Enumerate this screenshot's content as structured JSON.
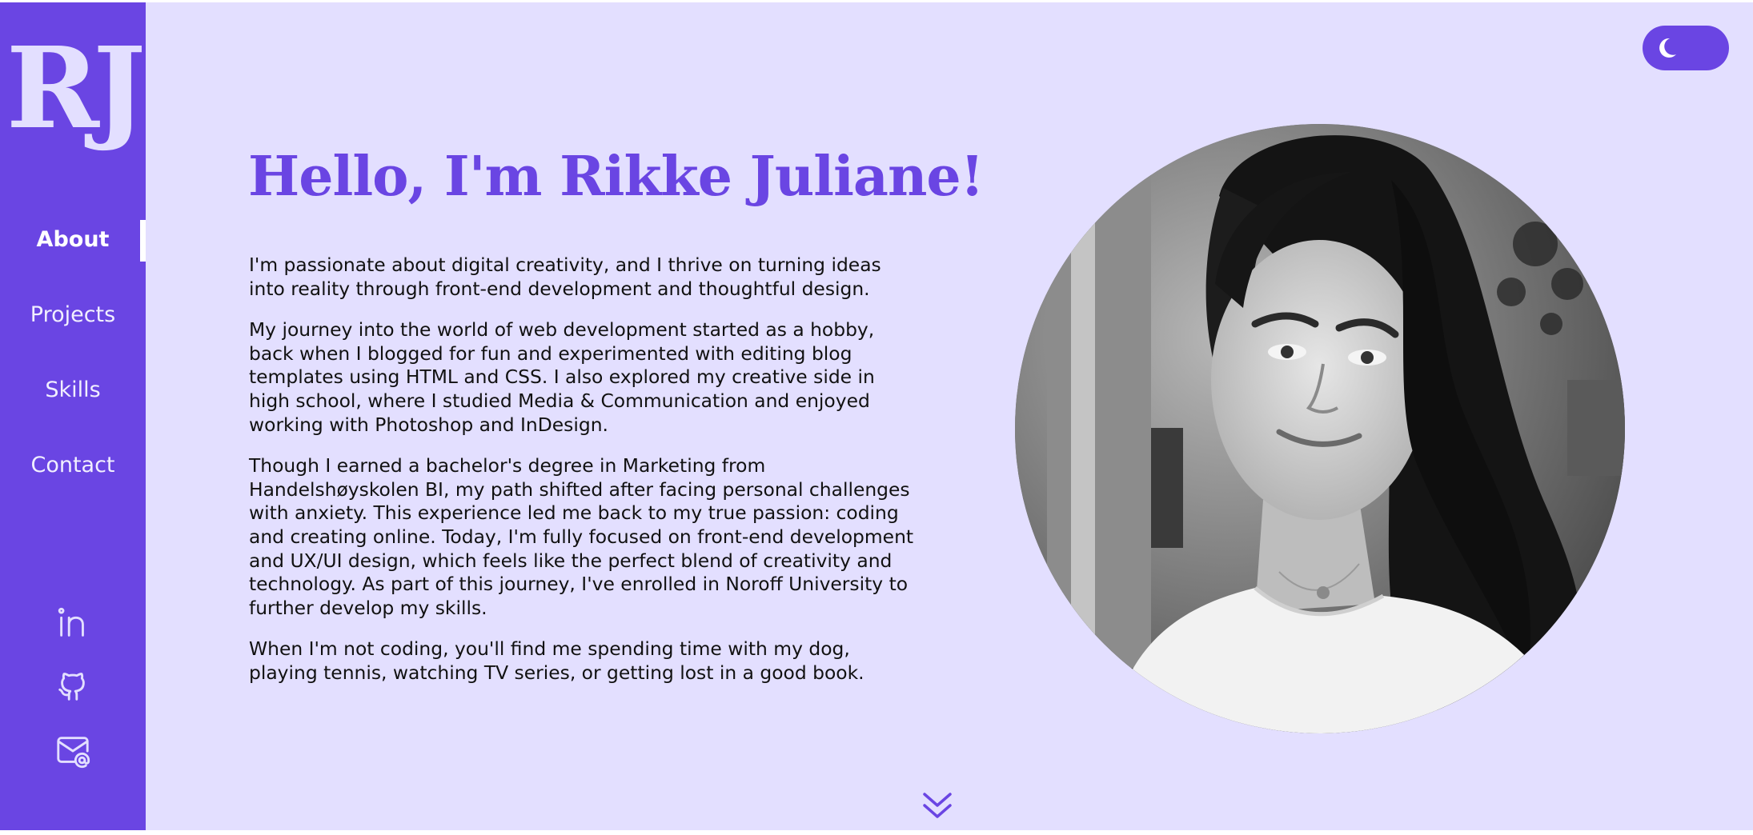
{
  "sidebar": {
    "logo": "RJ",
    "nav": [
      {
        "label": "About",
        "active": true
      },
      {
        "label": "Projects",
        "active": false
      },
      {
        "label": "Skills",
        "active": false
      },
      {
        "label": "Contact",
        "active": false
      }
    ],
    "social": [
      "linkedin-icon",
      "github-icon",
      "mail-icon"
    ]
  },
  "theme_toggle": {
    "icon": "moon-icon"
  },
  "main": {
    "heading": "Hello, I'm Rikke Juliane!",
    "paragraphs": [
      "I'm passionate about digital creativity, and I thrive on turning ideas into reality through front-end development and thoughtful design.",
      "My journey into the world of web development started as a hobby, back when I blogged for fun and experimented with editing blog templates using HTML and CSS. I also explored my creative side in high school, where I studied Media & Communication and enjoyed working with Photoshop and InDesign.",
      "Though I earned a bachelor's degree in Marketing from Handelshøyskolen BI, my path shifted after facing personal challenges with anxiety. This experience led me back to my true passion: coding and creating online. Today, I'm fully focused on front-end development and UX/UI design, which feels like the perfect blend of creativity and technology. As part of this journey, I've enrolled in Noroff University to further develop my skills.",
      "When I'm not coding, you'll find me spending time with my dog, playing tennis, watching TV series, or getting lost in a good book."
    ]
  },
  "scroll_icon": "double-chevron-down-icon",
  "colors": {
    "accent": "#6a45e3",
    "background": "#e3dfff",
    "text": "#111111"
  }
}
